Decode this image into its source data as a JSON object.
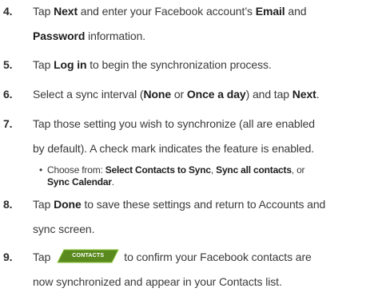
{
  "steps": [
    {
      "number": "4.",
      "line1": {
        "t1": "Tap ",
        "b1": "Next",
        "t2": " and enter your Facebook account’s ",
        "b2": "Email",
        "t3": " and"
      },
      "line2": {
        "b1": "Password",
        "t1": " information."
      }
    },
    {
      "number": "5.",
      "t1": "Tap ",
      "b1": "Log in",
      "t2": " to begin the synchronization process."
    },
    {
      "number": "6.",
      "t1": "Select a sync interval (",
      "b1": "None",
      "t2": " or ",
      "b2": "Once a day",
      "t3": ") and tap ",
      "b3": "Next",
      "t4": "."
    },
    {
      "number": "7.",
      "line1": "Tap those setting you wish to synchronize (all are enabled",
      "line2": "by default). A check mark indicates the feature is enabled."
    },
    {
      "number": "8.",
      "line1": {
        "t1": "Tap ",
        "b1": "Done",
        "t2": " to save these settings and return to Accounts and"
      },
      "line2": "sync screen."
    },
    {
      "number": "9.",
      "line1": {
        "t1": "Tap",
        "t2": "to confirm your Facebook contacts are"
      },
      "line2": "now synchronized and appear in your Contacts list."
    }
  ],
  "bullet": {
    "dot": "•",
    "t1": "Choose from: ",
    "b1": "Select Contacts to Sync",
    "t2": ", ",
    "b2": "Sync all contacts",
    "t3": ", or",
    "b3": "Sync Calendar",
    "t4": "."
  },
  "contacts_button": {
    "label": "CONTACTS",
    "color": "#5a8a1e"
  }
}
